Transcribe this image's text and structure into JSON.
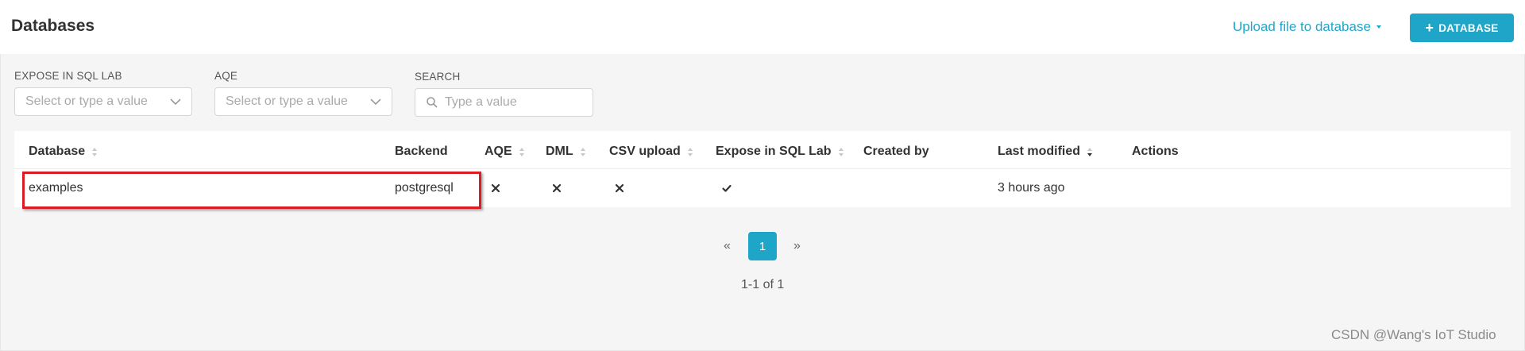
{
  "header": {
    "title": "Databases",
    "upload_label": "Upload file to database",
    "add_button_label": "DATABASE"
  },
  "filters": {
    "expose": {
      "label": "EXPOSE IN SQL LAB",
      "placeholder": "Select or type a value"
    },
    "aqe": {
      "label": "AQE",
      "placeholder": "Select or type a value"
    },
    "search": {
      "label": "SEARCH",
      "placeholder": "Type a value"
    }
  },
  "table": {
    "columns": [
      {
        "label": "Database",
        "sortable": true
      },
      {
        "label": "Backend",
        "sortable": false
      },
      {
        "label": "AQE",
        "sortable": true
      },
      {
        "label": "DML",
        "sortable": true
      },
      {
        "label": "CSV upload",
        "sortable": true
      },
      {
        "label": "Expose in SQL Lab",
        "sortable": true
      },
      {
        "label": "Created by",
        "sortable": false
      },
      {
        "label": "Last modified",
        "sortable": true,
        "sort_direction": "desc"
      },
      {
        "label": "Actions",
        "sortable": false
      }
    ],
    "rows": [
      {
        "database": "examples",
        "backend": "postgresql",
        "aqe": "cross-icon",
        "dml": "cross-icon",
        "csv_upload": "cross-icon",
        "expose_in_sql_lab": "check-icon",
        "created_by": "",
        "last_modified": "3 hours ago"
      }
    ]
  },
  "pagination": {
    "prev": "«",
    "current": "1",
    "next": "»",
    "summary": "1-1 of 1"
  },
  "watermark": "CSDN @Wang's IoT Studio",
  "colors": {
    "accent": "#1fa5c8",
    "highlight": "#d81e24",
    "background": "#f5f5f5"
  }
}
